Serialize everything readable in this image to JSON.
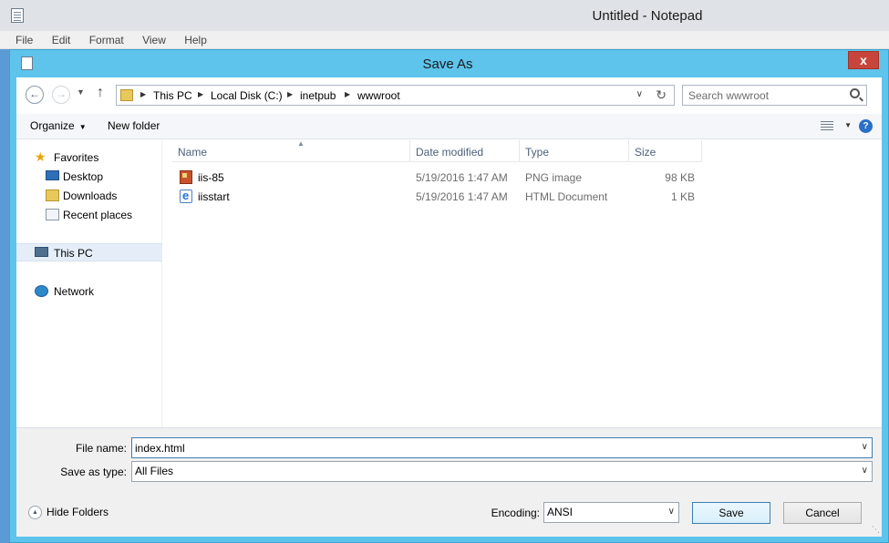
{
  "notepad": {
    "title": "Untitled - Notepad",
    "menu": [
      "File",
      "Edit",
      "Format",
      "View",
      "Help"
    ]
  },
  "dialog": {
    "title": "Save As",
    "close": "x"
  },
  "address": {
    "crumbs": [
      "This PC",
      "Local Disk (C:)",
      "inetpub",
      "wwwroot"
    ],
    "search_placeholder": "Search wwwroot"
  },
  "toolbar": {
    "organize": "Organize",
    "new_folder": "New folder",
    "help": "?"
  },
  "nav": {
    "favorites": "Favorites",
    "desktop": "Desktop",
    "downloads": "Downloads",
    "recent": "Recent places",
    "this_pc": "This PC",
    "network": "Network"
  },
  "columns": [
    "Name",
    "Date modified",
    "Type",
    "Size"
  ],
  "files": [
    {
      "name": "iis-85",
      "date": "5/19/2016 1:47 AM",
      "type": "PNG image",
      "size": "98 KB",
      "icon": "png-file-icon"
    },
    {
      "name": "iisstart",
      "date": "5/19/2016 1:47 AM",
      "type": "HTML Document",
      "size": "1 KB",
      "icon": "html-file-icon"
    }
  ],
  "form": {
    "file_name_label": "File name:",
    "file_name_value": "index.html",
    "save_type_label": "Save as type:",
    "save_type_value": "All Files",
    "encoding_label": "Encoding:",
    "encoding_value": "ANSI"
  },
  "footer": {
    "hide_folders": "Hide Folders",
    "save": "Save",
    "cancel": "Cancel"
  },
  "colors": {
    "dialog_frame": "#5ec4ec",
    "close_button": "#c7453a",
    "selected_nav": "#e5eef8"
  }
}
